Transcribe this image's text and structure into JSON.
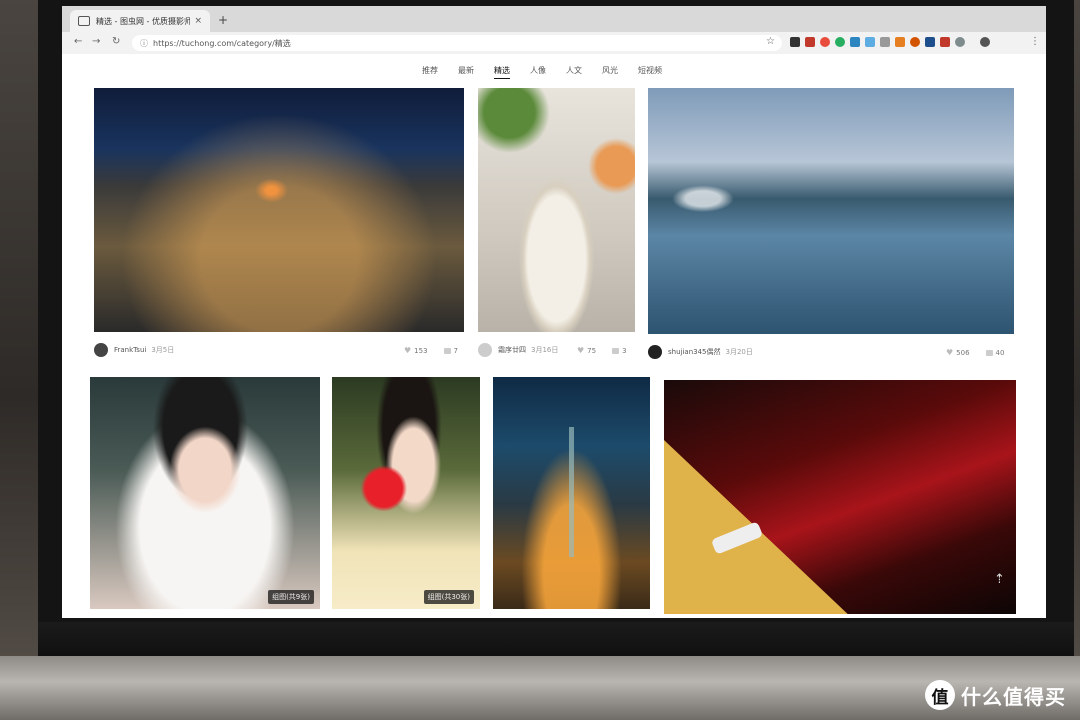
{
  "browser": {
    "tab_title": "精选 - 图虫网 - 优质摄影师交流",
    "tab_close": "×",
    "new_tab": "+",
    "back": "←",
    "forward": "→",
    "reload": "↻",
    "url": "https://tuchong.com/category/精选",
    "star": "☆",
    "menu": "⋮"
  },
  "categories": [
    {
      "label": "推荐"
    },
    {
      "label": "最新"
    },
    {
      "label": "精选",
      "active": true
    },
    {
      "label": "人像"
    },
    {
      "label": "人文"
    },
    {
      "label": "风光"
    },
    {
      "label": "短视频"
    }
  ],
  "posts_row1": [
    {
      "author": "FrankTsui",
      "date": "3月5日",
      "likes": "153",
      "comments": "7"
    },
    {
      "author": "霜序廿四",
      "date": "3月16日",
      "likes": "75",
      "comments": "3"
    },
    {
      "author": "shujian345偶然",
      "date": "3月20日",
      "likes": "506",
      "comments": "40"
    }
  ],
  "badges": {
    "girl_fur": "组图(共9张)",
    "girl_flower": "组图(共30张)"
  },
  "back_to_top": "⇡",
  "watermark": {
    "logo": "值",
    "text": "什么值得买"
  },
  "colors": {
    "accent": "#111111",
    "watermark": "#ffffff"
  }
}
